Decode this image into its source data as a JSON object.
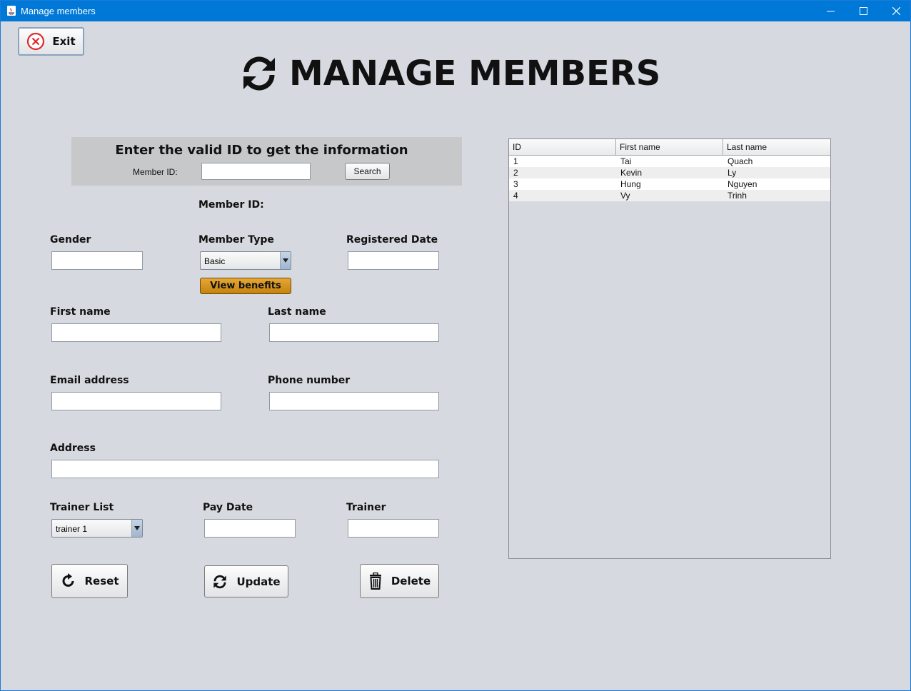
{
  "window": {
    "title": "Manage members"
  },
  "exit_button": {
    "label": "Exit"
  },
  "heading": {
    "title": "MANAGE MEMBERS"
  },
  "search": {
    "title": "Enter the valid ID to get the information",
    "member_id_label": "Member ID:",
    "member_id_value": "",
    "button_label": "Search"
  },
  "form": {
    "member_id_label": "Member ID:",
    "gender_label": "Gender",
    "gender_value": "",
    "member_type_label": "Member Type",
    "member_type_value": "Basic",
    "view_benefits_label": "View benefits",
    "registered_date_label": "Registered Date",
    "registered_date_value": "",
    "first_name_label": "First name",
    "first_name_value": "",
    "last_name_label": "Last name",
    "last_name_value": "",
    "email_label": "Email address",
    "email_value": "",
    "phone_label": "Phone number",
    "phone_value": "",
    "address_label": "Address",
    "address_value": "",
    "trainer_list_label": "Trainer List",
    "trainer_list_value": "trainer 1",
    "pay_date_label": "Pay Date",
    "pay_date_value": "",
    "trainer_label": "Trainer",
    "trainer_value": ""
  },
  "actions": {
    "reset_label": "Reset",
    "update_label": "Update",
    "delete_label": "Delete"
  },
  "table": {
    "columns": [
      "ID",
      "First name",
      "Last name"
    ],
    "rows": [
      [
        "1",
        "Tai",
        "Quach"
      ],
      [
        "2",
        "Kevin",
        "Ly"
      ],
      [
        "3",
        "Hung",
        "Nguyen"
      ],
      [
        "4",
        "Vy",
        "Trinh"
      ]
    ]
  },
  "colors": {
    "titlebar": "#0078d7",
    "background": "#d6d9df",
    "benefits_button": "#d4921f",
    "exit_icon": "#e0282e"
  }
}
